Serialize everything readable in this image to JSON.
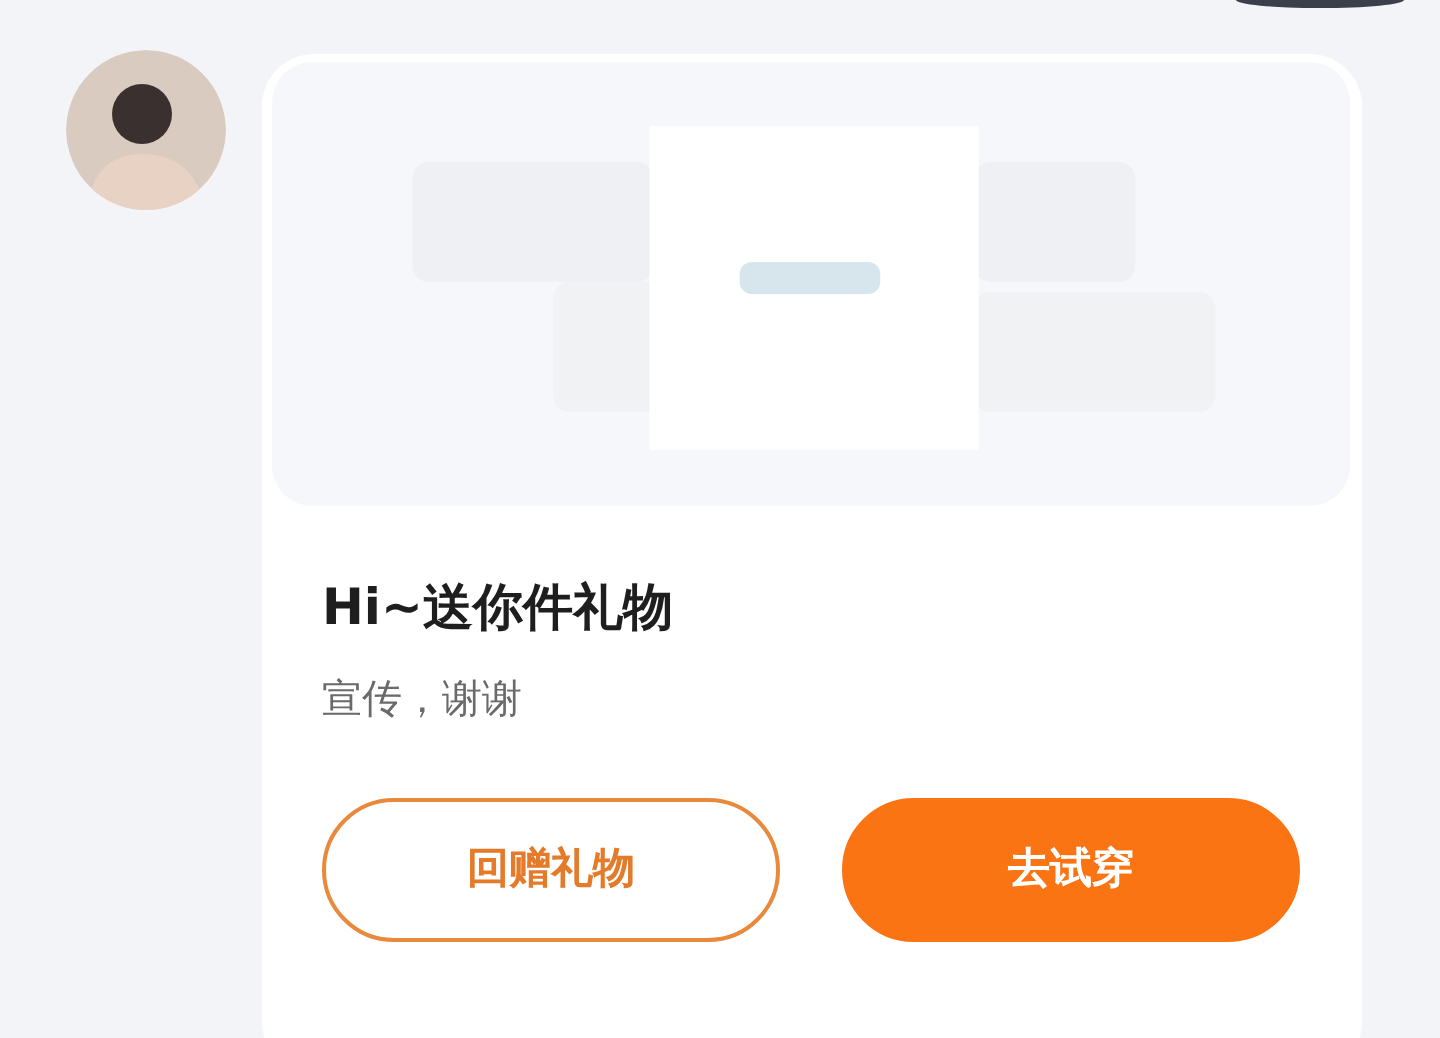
{
  "message": {
    "title": "Hi~送你件礼物",
    "subtitle": "宣传，谢谢",
    "buttons": [
      {
        "label": "回赠礼物",
        "kind": "outline"
      },
      {
        "label": "去试穿",
        "kind": "filled"
      }
    ]
  }
}
